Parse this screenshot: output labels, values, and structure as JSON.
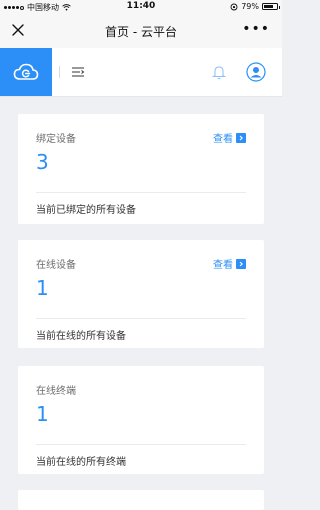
{
  "status_bar": {
    "carrier": "中国移动",
    "time": "11:40",
    "battery": "79%",
    "battery_level": 0.79
  },
  "nav_bar": {
    "title": "首页 - 云平台",
    "close_icon": "close-icon",
    "more_icon": "more-icon",
    "more_glyph": "•••"
  },
  "header": {
    "logo_icon": "cloud-logo-icon",
    "menu_icon": "menu-toggle-icon",
    "bell_icon": "bell-icon",
    "avatar_icon": "user-avatar-icon",
    "accent_color": "#2b8ff7"
  },
  "cards": [
    {
      "title": "绑定设备",
      "link": "查看",
      "value": "3",
      "desc": "当前已绑定的所有设备"
    },
    {
      "title": "在线设备",
      "link": "查看",
      "value": "1",
      "desc": "当前在线的所有设备"
    },
    {
      "title": "在线终端",
      "value": "1",
      "desc": "当前在线的所有终端"
    }
  ]
}
